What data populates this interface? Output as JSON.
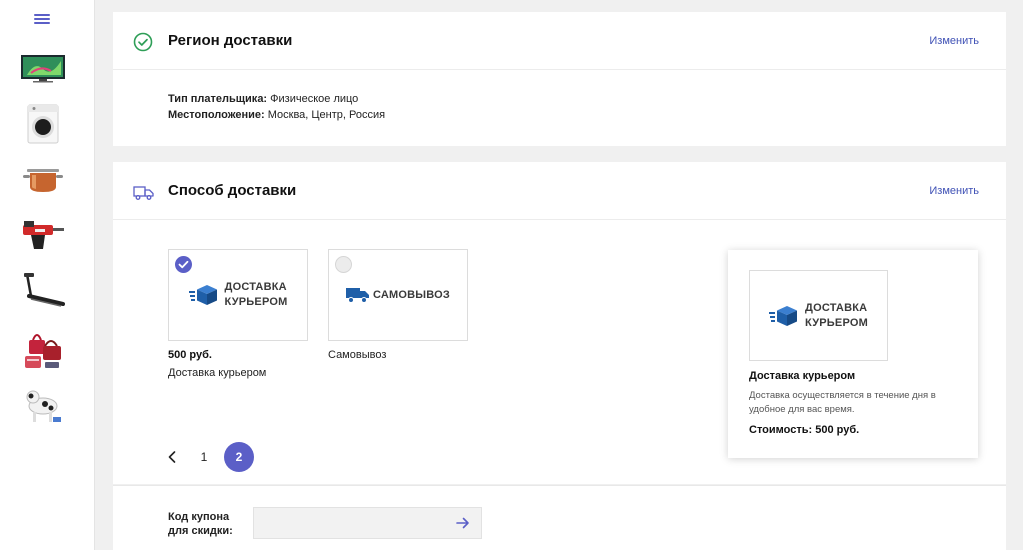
{
  "sidebar": {
    "menu_icon": "hamburger-icon",
    "thumbnails": [
      {
        "name": "tv-thumbnail"
      },
      {
        "name": "washing-machine-thumbnail"
      },
      {
        "name": "saucepan-thumbnail"
      },
      {
        "name": "drill-thumbnail"
      },
      {
        "name": "treadmill-thumbnail"
      },
      {
        "name": "handbags-thumbnail"
      },
      {
        "name": "dog-thumbnail"
      }
    ]
  },
  "region": {
    "title": "Регион доставки",
    "change_label": "Изменить",
    "icon": "check-circle-icon",
    "payer_label": "Тип плательщика:",
    "payer_value": "Физическое лицо",
    "location_label": "Местоположение:",
    "location_value": "Москва, Центр, Россия"
  },
  "delivery": {
    "title": "Способ доставки",
    "change_label": "Изменить",
    "icon": "truck-icon",
    "options": [
      {
        "logo_line1": "ДОСТАВКА",
        "logo_line2": "КУРЬЕРОМ",
        "price": "500 руб.",
        "name": "Доставка курьером",
        "selected": true
      },
      {
        "logo_line1": "САМОВЫВОЗ",
        "price": "",
        "name": "Самовывоз",
        "selected": false
      }
    ],
    "pagination": {
      "pages": [
        "1",
        "2"
      ],
      "current": "2"
    },
    "detail": {
      "logo_line1": "ДОСТАВКА",
      "logo_line2": "КУРЬЕРОМ",
      "name": "Доставка курьером",
      "description": "Доставка осуществляется в течение дня в удобное для вас время.",
      "cost": "Стоимость: 500 руб."
    }
  },
  "coupon": {
    "label_line1": "Код купона",
    "label_line2": "для скидки:",
    "value": "",
    "submit_icon": "arrow-right-icon"
  },
  "colors": {
    "accent": "#5b5fc7",
    "link": "#3f51b5",
    "success": "#2e9e57",
    "logo_blue": "#1f5fa8"
  }
}
